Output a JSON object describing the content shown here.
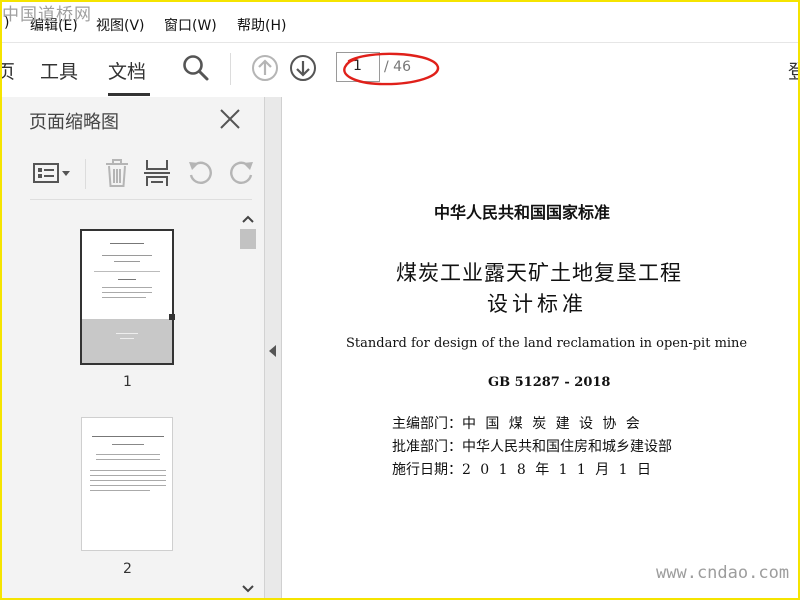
{
  "watermark_top": "中国道桥网",
  "watermark_bottom": "www.cndao.com",
  "menu": {
    "cut_item": ")",
    "items": [
      "编辑(E)",
      "视图(V)",
      "窗口(W)",
      "帮助(H)"
    ]
  },
  "toolbar": {
    "tab_cut_left": "页",
    "tab_tools": "工具",
    "tab_document": "文档",
    "right_cut": "登",
    "page_current": "1",
    "page_total": "/ 46",
    "icons": [
      "search-icon",
      "page-up-icon",
      "page-down-icon"
    ]
  },
  "thumbnail_panel": {
    "title": "页面缩略图",
    "icons": [
      "options-menu-icon",
      "delete-icon",
      "insert-page-icon",
      "undo-icon",
      "redo-icon",
      "close-icon"
    ],
    "thumbnails": [
      {
        "number": "1",
        "selected": true
      },
      {
        "number": "2",
        "selected": false
      }
    ]
  },
  "document": {
    "heading": "中华人民共和国国家标准",
    "title_line1": "煤炭工业露天矿土地复垦工程",
    "title_line2": "设计标准",
    "english_title": "Standard for design of the land reclamation in open-pit mine",
    "code": "GB 51287 - 2018",
    "fields": [
      {
        "label": "主编部门：",
        "value": "中国煤炭建设协会"
      },
      {
        "label": "批准部门：",
        "value": "中华人民共和国住房和城乡建设部"
      },
      {
        "label": "施行日期：",
        "value": "2018年11月1日"
      }
    ]
  },
  "colors": {
    "frame_border": "#f5e400",
    "annotation_red": "#e0201a",
    "toolbar_bg": "#ffffff",
    "panel_bg": "#f3f3f3",
    "document_bg": "#ffffff"
  }
}
